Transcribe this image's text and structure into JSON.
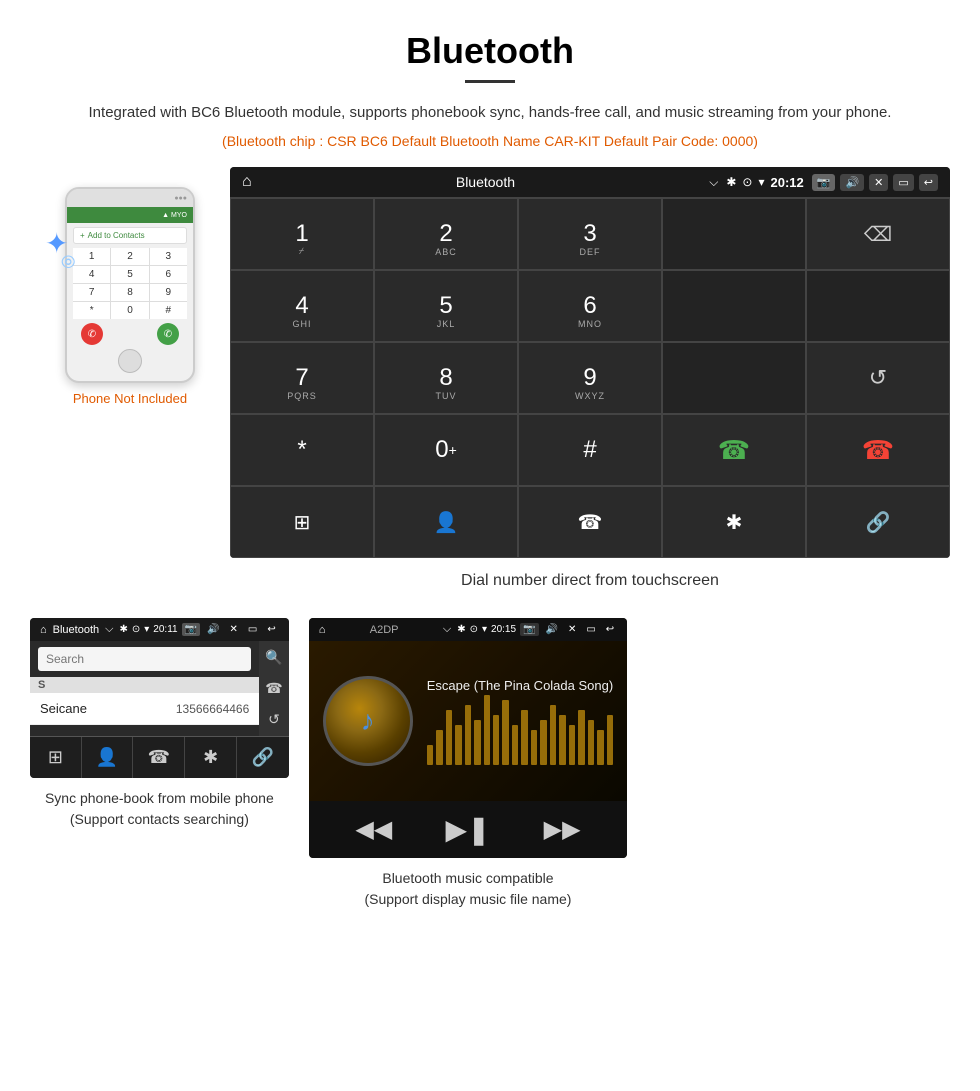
{
  "page": {
    "title": "Bluetooth",
    "subtitle": "Integrated with BC6 Bluetooth module, supports phonebook sync, hands-free call, and music streaming from your phone.",
    "spec_line": "(Bluetooth chip : CSR BC6    Default Bluetooth Name CAR-KIT    Default Pair Code: 0000)",
    "main_caption": "Dial number direct from touchscreen",
    "bottom_left_caption": "Sync phone-book from mobile phone\n(Support contacts searching)",
    "bottom_right_caption": "Bluetooth music compatible\n(Support display music file name)",
    "phone_not_included": "Phone Not Included"
  },
  "main_screen": {
    "status": {
      "title": "Bluetooth",
      "time": "20:12"
    },
    "dialpad": [
      {
        "key": "1",
        "sub": "⌿"
      },
      {
        "key": "2",
        "sub": "ABC"
      },
      {
        "key": "3",
        "sub": "DEF"
      },
      {
        "key": "",
        "sub": ""
      },
      {
        "key": "⌫",
        "sub": ""
      }
    ],
    "row2": [
      {
        "key": "4",
        "sub": "GHI"
      },
      {
        "key": "5",
        "sub": "JKL"
      },
      {
        "key": "6",
        "sub": "MNO"
      },
      {
        "key": "",
        "sub": ""
      },
      {
        "key": "",
        "sub": ""
      }
    ],
    "row3": [
      {
        "key": "7",
        "sub": "PQRS"
      },
      {
        "key": "8",
        "sub": "TUV"
      },
      {
        "key": "9",
        "sub": "WXYZ"
      },
      {
        "key": "",
        "sub": ""
      },
      {
        "key": "↺",
        "sub": ""
      }
    ],
    "row4": [
      {
        "key": "*",
        "sub": ""
      },
      {
        "key": "0+",
        "sub": ""
      },
      {
        "key": "#",
        "sub": ""
      },
      {
        "key": "📞",
        "sub": "call"
      },
      {
        "key": "📞",
        "sub": "hangup"
      }
    ],
    "bottom_icons": [
      "⊞",
      "👤",
      "📞",
      "✱",
      "🔗"
    ]
  },
  "contacts_screen": {
    "status_title": "Bluetooth",
    "time": "20:11",
    "search_placeholder": "Search",
    "contact": {
      "letter": "S",
      "name": "Seicane",
      "number": "13566664466"
    }
  },
  "music_screen": {
    "status_title": "A2DP",
    "time": "20:15",
    "song_title": "Escape (The Pina Colada Song)",
    "eq_bars": [
      20,
      35,
      55,
      40,
      60,
      45,
      70,
      50,
      65,
      40,
      55,
      35,
      45,
      60,
      50,
      40,
      55,
      45,
      35,
      50
    ]
  }
}
